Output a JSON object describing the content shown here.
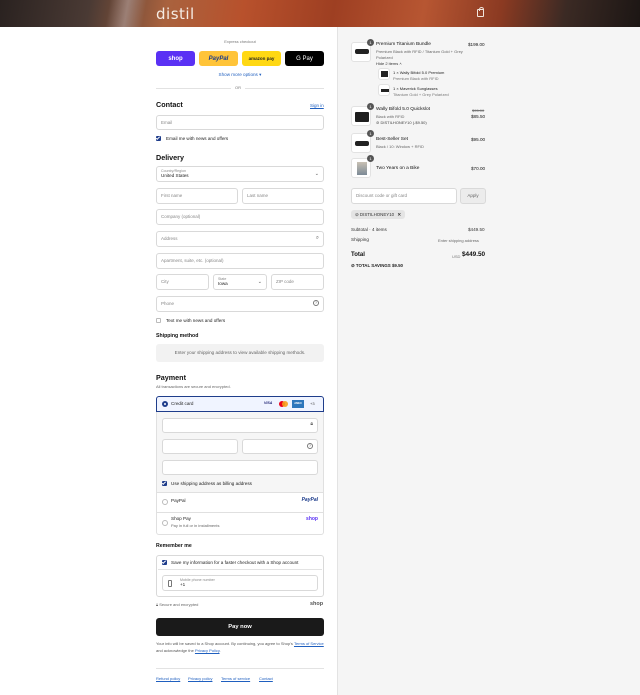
{
  "header": {
    "logo": "distil"
  },
  "express": {
    "title": "Express checkout",
    "shop": "shop",
    "paypal": "PayPal",
    "amazon": "amazon pay",
    "gpay": "G Pay",
    "more": "Show more options",
    "or": "OR"
  },
  "contact": {
    "title": "Contact",
    "signin": "Sign in",
    "email_placeholder": "Email",
    "news": "Email me with news and offers"
  },
  "delivery": {
    "title": "Delivery",
    "country_label": "Country/Region",
    "country": "United States",
    "first": "First name",
    "last": "Last name",
    "company": "Company (optional)",
    "address": "Address",
    "apartment": "Apartment, suite, etc. (optional)",
    "city": "City",
    "state_label": "State",
    "state": "Iowa",
    "zip": "ZIP code",
    "phone": "Phone",
    "text_me": "Text me with news and offers"
  },
  "shipping": {
    "title": "Shipping method",
    "note": "Enter your shipping address to view available shipping methods."
  },
  "payment": {
    "title": "Payment",
    "subtitle": "All transactions are secure and encrypted.",
    "credit": "Credit card",
    "visa": "VISA",
    "amex": "AMEX",
    "more_cards": "+3",
    "billing": "Use shipping address as billing address",
    "paypal": "PayPal",
    "paypal_logo": "PayPal",
    "shoppay": "Shop Pay",
    "shoppay_sub": "Pay in full or in installments",
    "shoppay_logo": "shop"
  },
  "remember": {
    "title": "Remember me",
    "save": "Save my information for a faster checkout with a Shop account",
    "mobile_label": "Mobile phone number",
    "mobile_value": "+1",
    "secure": "Secure and encrypted",
    "shop": "shop"
  },
  "paynow": "Pay now",
  "legal": {
    "line1": "Your info will be saved to a Shop account. By continuing, you agree to Shop's",
    "tos": "Terms of Service",
    "and": "and acknowledge the",
    "privacy": "Privacy Policy",
    "end": "."
  },
  "footer": [
    "Refund policy",
    "Privacy policy",
    "Terms of service",
    "Contact"
  ],
  "summary": {
    "items": [
      {
        "qty": "1",
        "name": "Premium Titanium Bundle",
        "desc": "Premium Black with RFID / Titanium Gold + Grey Polarized",
        "price": "$199.00",
        "toggle": "Hide 2 items"
      },
      {
        "qty": "1",
        "name": "Wally Bifold 5.0 Quickslot",
        "desc": "Black with RFID",
        "discount": "DISTILHONEY10 (-$9.50)",
        "old": "$95.00",
        "price": "$85.50"
      },
      {
        "qty": "1",
        "name": "Best-Seller Set",
        "desc": "Black / 10: Window + RFID",
        "price": "$95.00"
      },
      {
        "qty": "1",
        "name": "Two Years on a Bike",
        "price": "$70.00"
      }
    ],
    "sub_items": [
      {
        "name": "1 × Wally Bifold 5.0 Premium",
        "desc": "Premium Black with RFID"
      },
      {
        "name": "1 × Maverick Sunglasses",
        "desc": "Titanium Gold + Grey Polarized"
      }
    ],
    "discount_placeholder": "Discount code or gift card",
    "apply": "Apply",
    "code": "DISTILHONEY10",
    "subtotal_label": "Subtotal · 4 items",
    "subtotal": "$449.50",
    "shipping_label": "Shipping",
    "shipping": "Enter shipping address",
    "total_label": "Total",
    "currency": "USD",
    "total": "$449.50",
    "savings_label": "TOTAL SAVINGS",
    "savings": "$9.50"
  }
}
